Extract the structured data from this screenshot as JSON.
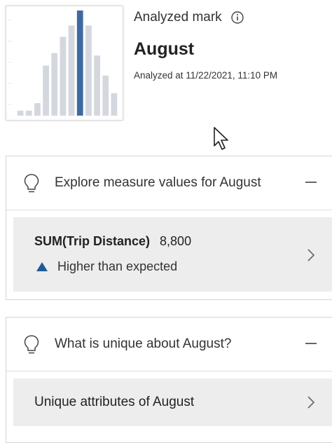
{
  "header": {
    "analyzed_label": "Analyzed mark",
    "mark_name": "August",
    "analyzed_at": "Analyzed at 11/22/2021, 11:10 PM"
  },
  "thumbnail": {
    "bar_values": [
      4,
      4,
      10,
      40,
      50,
      63,
      72,
      84,
      72,
      48,
      32,
      18
    ],
    "highlight_index": 7,
    "colors": {
      "bar": "#d4d8de",
      "highlight": "#3d6aa0"
    }
  },
  "sections": [
    {
      "title": "Explore measure values for August",
      "measure_name": "SUM(Trip Distance)",
      "measure_value": "8,800",
      "expectation": "Higher than expected",
      "icons": [
        "lightbulb-icon",
        "minus-icon",
        "up-triangle-icon",
        "chevron-right-icon"
      ]
    },
    {
      "title": "What is unique about August?",
      "row_label": "Unique attributes of August",
      "icons": [
        "lightbulb-icon",
        "minus-icon",
        "chevron-right-icon"
      ]
    }
  ]
}
